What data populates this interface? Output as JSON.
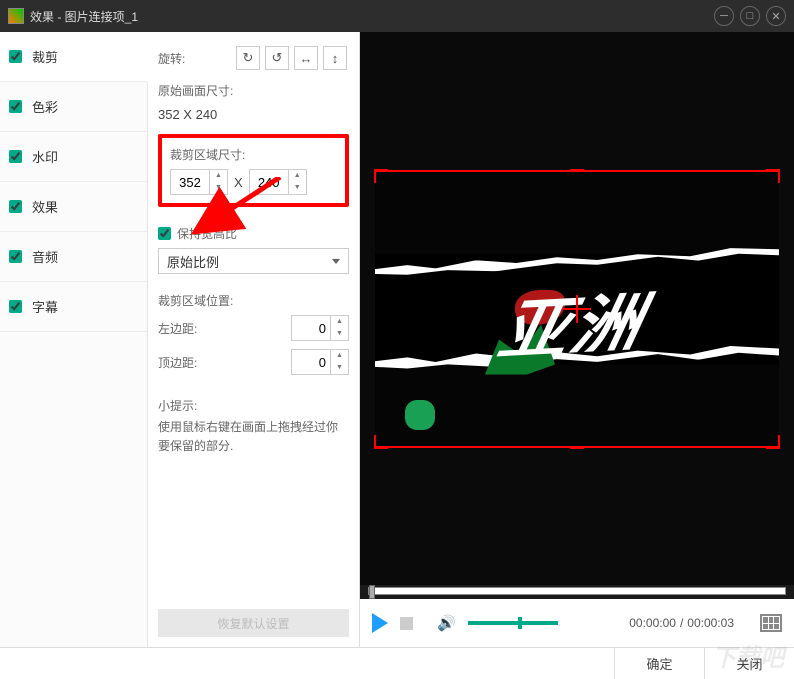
{
  "window": {
    "title": "效果 - 图片连接项_1"
  },
  "sidebar": {
    "items": [
      {
        "label": "裁剪",
        "checked": true,
        "selected": true
      },
      {
        "label": "色彩",
        "checked": true
      },
      {
        "label": "水印",
        "checked": true
      },
      {
        "label": "效果",
        "checked": true
      },
      {
        "label": "音频",
        "checked": true
      },
      {
        "label": "字幕",
        "checked": true
      }
    ]
  },
  "settings": {
    "rotate_label": "旋转:",
    "orig_size_label": "原始画面尺寸:",
    "orig_size_value": "352 X 240",
    "crop_size_label": "裁剪区域尺寸:",
    "crop_w": "352",
    "crop_x": "X",
    "crop_h": "240",
    "keep_ratio_label": "保持宽高比",
    "ratio_value": "原始比例",
    "crop_pos_label": "裁剪区域位置:",
    "left_margin_label": "左边距:",
    "left_margin_value": "0",
    "top_margin_label": "顶边距:",
    "top_margin_value": "0",
    "tip_label": "小提示:",
    "tip_text": "使用鼠标右键在画面上拖拽经过你要保留的部分.",
    "restore_btn": "恢复默认设置"
  },
  "player": {
    "time_current": "00:00:00",
    "time_sep": "/",
    "time_total": "00:00:03"
  },
  "footer": {
    "ok": "确定",
    "close": "关闭"
  }
}
